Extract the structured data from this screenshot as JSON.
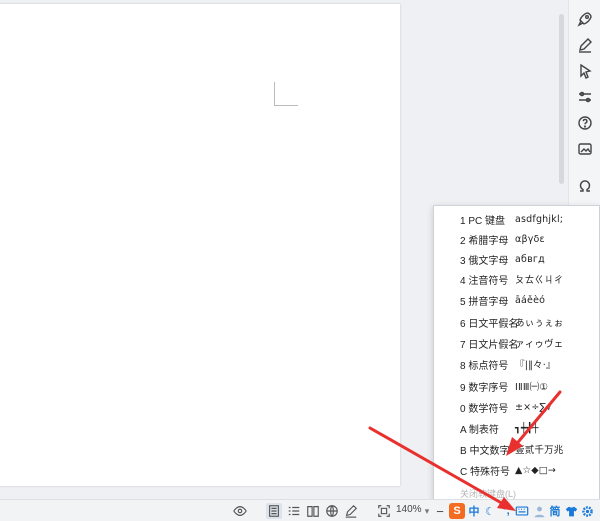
{
  "menu": {
    "items": [
      {
        "label": "1 PC 键盘",
        "sample": "asdfghjkl;"
      },
      {
        "label": "2 希腊字母",
        "sample": "αβγδε"
      },
      {
        "label": "3 俄文字母",
        "sample": "абвгд"
      },
      {
        "label": "4 注音符号",
        "sample": "ㄆㄊㄍㄐㄔ"
      },
      {
        "label": "5 拼音字母",
        "sample": "āáěèó"
      },
      {
        "label": "6 日文平假名",
        "sample": "あぃぅぇぉ"
      },
      {
        "label": "7 日文片假名",
        "sample": "ァィゥヴェ"
      },
      {
        "label": "8 标点符号",
        "sample": "『|‖々·』"
      },
      {
        "label": "9 数字序号",
        "sample": "ⅠⅡⅢ㈠①"
      },
      {
        "label": "0 数学符号",
        "sample": "±×÷∑√"
      },
      {
        "label": "A 制表符",
        "sample": "┓┿╋┼"
      },
      {
        "label": "B 中文数字",
        "sample": "壹贰千万兆"
      },
      {
        "label": "C 特殊符号",
        "sample": "▲☆◆□→"
      }
    ],
    "footer": "关闭软键盘(L)"
  },
  "status_bar": {
    "zoom": "140%",
    "zoom_minus": "−",
    "ime_zh": "中",
    "ime_simplified": "简"
  },
  "colors": {
    "arrow": "#e8312f",
    "ime_blue": "#1a7ad9",
    "ime_orange": "#f36c21"
  },
  "icons": {
    "rail": [
      "rocket-icon",
      "pen-icon",
      "pointer-icon",
      "sliders-icon",
      "help-icon",
      "image-edit-icon",
      "omega-icon"
    ],
    "status": [
      "eye-icon",
      "page-view-icon",
      "outline-icon",
      "book-icon",
      "globe-icon",
      "pen-icon",
      "fit-screen-icon",
      "soft-keyboard-icon"
    ]
  }
}
